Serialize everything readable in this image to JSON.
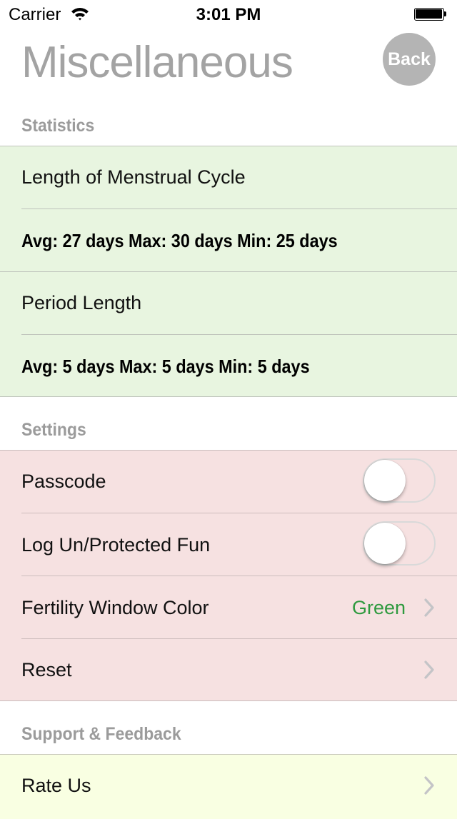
{
  "status_bar": {
    "carrier": "Carrier",
    "time": "3:01 PM"
  },
  "header": {
    "title": "Miscellaneous",
    "back_label": "Back"
  },
  "statistics": {
    "header": "Statistics",
    "cycle": {
      "label": "Length of Menstrual Cycle",
      "summary": "Avg: 27 days  Max: 30 days  Min: 25 days"
    },
    "period": {
      "label": "Period Length",
      "summary": "Avg: 5 days  Max: 5 days  Min: 5 days"
    }
  },
  "settings": {
    "header": "Settings",
    "passcode": {
      "label": "Passcode",
      "enabled": false
    },
    "log_fun": {
      "label": "Log Un/Protected Fun",
      "enabled": false
    },
    "fertility": {
      "label": "Fertility Window Color",
      "value": "Green",
      "value_color": "#2f9a3f"
    },
    "reset": {
      "label": "Reset"
    }
  },
  "support": {
    "header": "Support & Feedback",
    "rate": {
      "label": "Rate Us"
    }
  },
  "colors": {
    "statistics_bg": "#e8f5e0",
    "settings_bg": "#f6e1e1",
    "support_bg": "#f9ffe2",
    "back_button": "#b4b4b4",
    "title": "#a3a3a3"
  }
}
